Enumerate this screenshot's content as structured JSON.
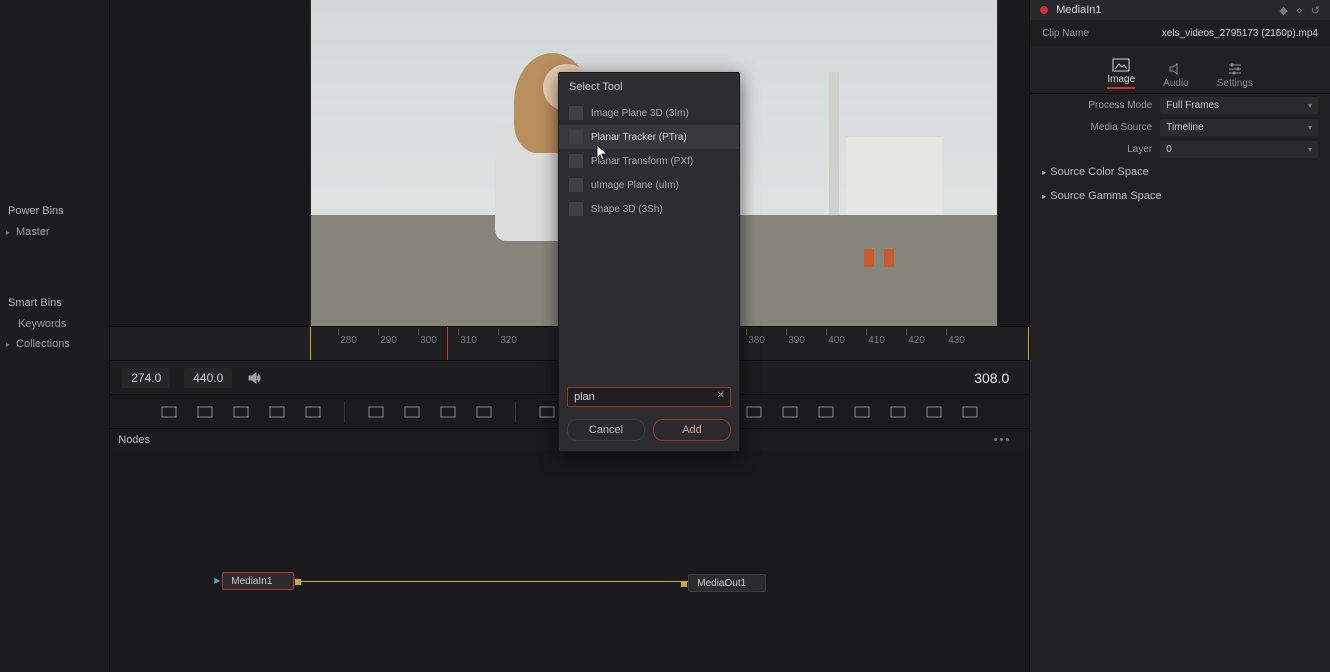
{
  "left": {
    "power_bins": "Power Bins",
    "master": "Master",
    "smart_bins": "Smart Bins",
    "keywords": "Keywords",
    "collections": "Collections"
  },
  "ruler": {
    "ticks": [
      "280",
      "290",
      "300",
      "310",
      "320",
      "380",
      "390",
      "400",
      "410",
      "420",
      "430"
    ]
  },
  "transport": {
    "in": "274.0",
    "out": "440.0",
    "current": "308.0"
  },
  "nodes": {
    "header": "Nodes",
    "media_in": "MediaIn1",
    "media_out": "MediaOut1"
  },
  "dialog": {
    "title": "Select Tool",
    "items": [
      "Image Plane 3D (3Im)",
      "Planar Tracker (PTra)",
      "Planar Transform (PXf)",
      "uImage Plane (uIm)",
      "Shape 3D (3Sh)"
    ],
    "search": "plan",
    "cancel": "Cancel",
    "add": "Add"
  },
  "inspector": {
    "node": "MediaIn1",
    "clip_label": "Clip Name",
    "clip_value": "xels_videos_2795173 (2160p).mp4",
    "tabs": {
      "image": "Image",
      "audio": "Audio",
      "settings": "Settings"
    },
    "process_mode_label": "Process Mode",
    "process_mode_value": "Full Frames",
    "media_source_label": "Media Source",
    "media_source_value": "Timeline",
    "layer_label": "Layer",
    "layer_value": "0",
    "src_color": "Source Color Space",
    "src_gamma": "Source Gamma Space"
  },
  "icons": {
    "shelf": [
      "background-node",
      "merge-node",
      "text-node",
      "paint-node",
      "sparkle",
      "brush",
      "pen",
      "color-wheel",
      "drop",
      "channel-bool",
      "channel-bool-2",
      "matte-control",
      "resize",
      "crop",
      "transform",
      "tracker",
      "particles",
      "stabilize",
      "3d-cube",
      "fog",
      "cloud"
    ]
  }
}
